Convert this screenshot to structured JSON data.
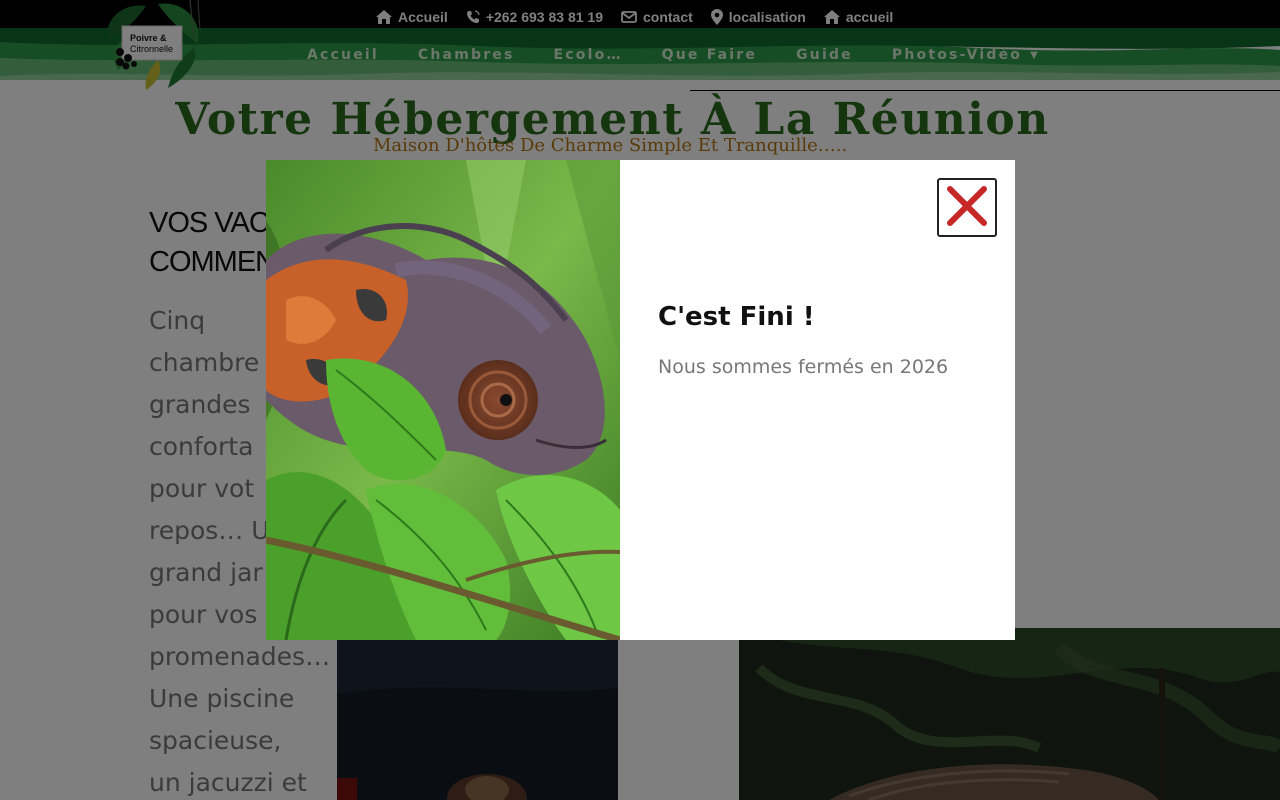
{
  "topbar": {
    "links": [
      {
        "label": "Accueil",
        "icon": "home-icon"
      },
      {
        "label": "+262 693 83 81 19",
        "icon": "phone-icon"
      },
      {
        "label": "contact",
        "icon": "envelope-icon"
      },
      {
        "label": "localisation",
        "icon": "map-marker-icon"
      },
      {
        "label": "accueil",
        "icon": "home-icon"
      }
    ]
  },
  "logo": {
    "line1": "Poivre &",
    "line2": "Citronnelle"
  },
  "nav": {
    "items": [
      {
        "label": "Accueil"
      },
      {
        "label": "Chambres"
      },
      {
        "label": "Ecolo…"
      },
      {
        "label": "Que Faire"
      },
      {
        "label": "Guide"
      },
      {
        "label": "Photos-Vidéo",
        "has_dropdown": true
      }
    ]
  },
  "hero": {
    "title": "Votre Hébergement À La Réunion",
    "subtitle": "Maison D'hôtes De Charme Simple Et Tranquille….."
  },
  "section": {
    "heading_line1": "VOS VACA",
    "heading_line2": "COMMEN",
    "body_lines": [
      "Cinq",
      "chambre",
      "grandes",
      "conforta",
      "pour vot",
      "repos… U",
      "grand jar",
      "pour vos",
      "promenades…",
      "Une piscine",
      "spacieuse,",
      "un jacuzzi et"
    ]
  },
  "modal": {
    "title": "C'est Fini !",
    "text": "Nous sommes fermés en 2026",
    "close_icon": "close-icon",
    "image": "chameleon-photo"
  },
  "colors": {
    "topbar_bg": "#000000",
    "nav_green": "#1f8a3a",
    "title_green": "#2a6a1f",
    "subtitle_gold": "#b27612",
    "close_red": "#c62828"
  }
}
